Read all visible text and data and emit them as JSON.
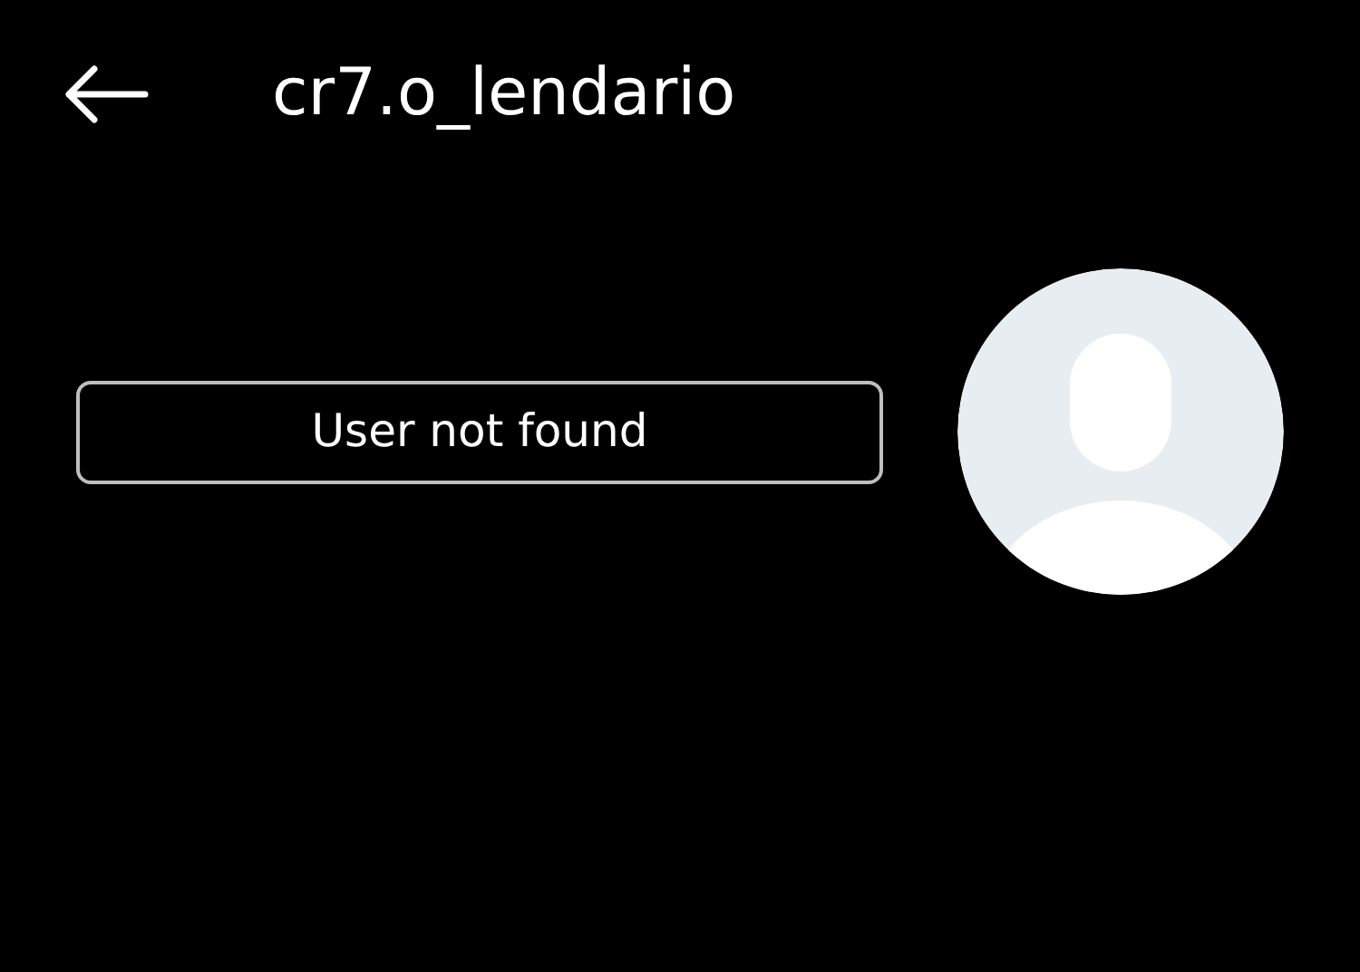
{
  "header": {
    "title": "cr7.o_lendario"
  },
  "profile": {
    "status_button": "User not found"
  }
}
